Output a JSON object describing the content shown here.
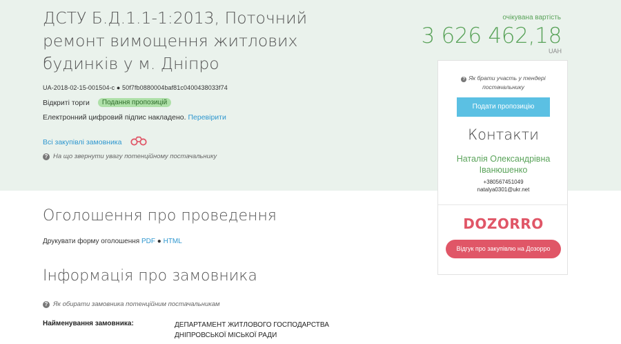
{
  "tender": {
    "title": "ДСТУ Б.Д.1.1-1:2013, Поточний ремонт вимощення житлових будинків у м. Дніпро",
    "id": "UA-2018-02-15-001504-c ● 50f7fb0880004baf81c0400438033f74",
    "procedure": "Відкриті торги",
    "status": "Подання пропозицій",
    "signature_text": "Електронний цифровий підпис накладено.",
    "signature_link": "Перевірити",
    "all_purchases_link": "Всі закупівлі замовника",
    "attention_note": "На що звернути увагу потенційному постачальнику"
  },
  "cost": {
    "label": "очікувана вартість",
    "value": "3 626 462,18",
    "currency": "UAH"
  },
  "card": {
    "how_to": "Як брати участь у тендері постачальнику",
    "submit_label": "Подати пропозицію",
    "contacts_title": "Контакти",
    "contact_name": "Наталія Олександрівна Іванюшенко",
    "contact_phone": "+380567451049",
    "contact_email": "natalya0301@ukr.net",
    "logo": "DOZORRO",
    "review_label": "Відгук про закупівлю на Дозорро"
  },
  "announcement": {
    "title": "Оголошення про проведення",
    "print_text": "Друкувати форму оголошення",
    "pdf": "PDF",
    "separator": " ● ",
    "html": "HTML"
  },
  "customer": {
    "title": "Інформація про замовника",
    "note": "Як обирати замовника потенційним постачальникам",
    "name_label": "Найменування замовника:",
    "name_value": "ДЕПАРТАМЕНТ ЖИТЛОВОГО ГОСПОДАРСТВА ДНІПРОВСЬКОЇ МІСЬКОЇ РАДИ"
  },
  "colors": {
    "hero_bg": "#eaf2ec",
    "accent_green": "#5aa35a",
    "link_blue": "#2f97cf",
    "dozorro_red": "#e05667"
  },
  "icons": [
    "question-icon",
    "binoculars-icon"
  ]
}
